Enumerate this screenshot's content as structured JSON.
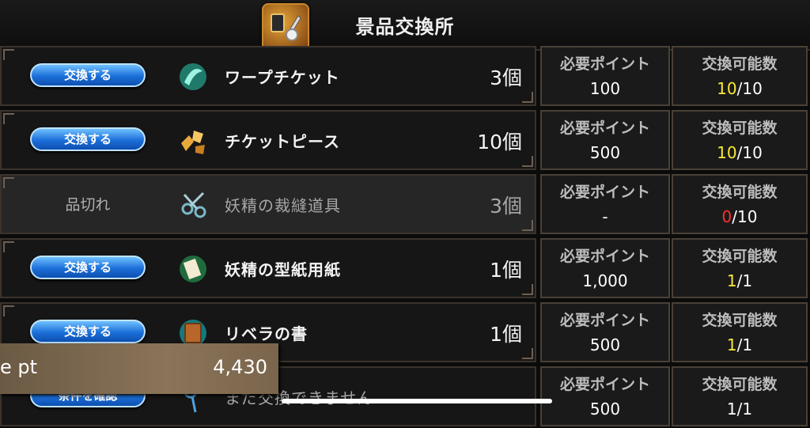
{
  "header": {
    "title": "景品交換所"
  },
  "columns": {
    "points_label": "必要ポイント",
    "count_label": "交換可能数"
  },
  "rows": [
    {
      "button": "交換する",
      "name": "ワープチケット",
      "qty": "3個",
      "points": "100",
      "count_have": "10",
      "count_sep": "/",
      "count_max": "10"
    },
    {
      "button": "交換する",
      "name": "チケットピース",
      "qty": "10個",
      "points": "500",
      "count_have": "10",
      "count_sep": "/",
      "count_max": "10"
    },
    {
      "button": "品切れ",
      "name": "妖精の裁縫道具",
      "qty": "3個",
      "points": "-",
      "count_have": "0",
      "count_sep": "/",
      "count_max": "10"
    },
    {
      "button": "交換する",
      "name": "妖精の型紙用紙",
      "qty": "1個",
      "points": "1,000",
      "count_have": "1",
      "count_sep": "/",
      "count_max": "1"
    },
    {
      "button": "交換する",
      "name": "リベラの書",
      "qty": "1個",
      "points": "500",
      "count_have": "1",
      "count_sep": "/",
      "count_max": "1"
    },
    {
      "button": "条件を確認",
      "name": "まだ交換できません",
      "qty": "",
      "points": "500",
      "count_have": "1",
      "count_sep": "/",
      "count_max": "1"
    }
  ],
  "points_box": {
    "label": "e pt",
    "value": "4,430"
  },
  "colors": {
    "accent_yellow": "#f7ea37",
    "soldout_red": "#ff2e2e",
    "button_blue": "#1c6fd9"
  }
}
